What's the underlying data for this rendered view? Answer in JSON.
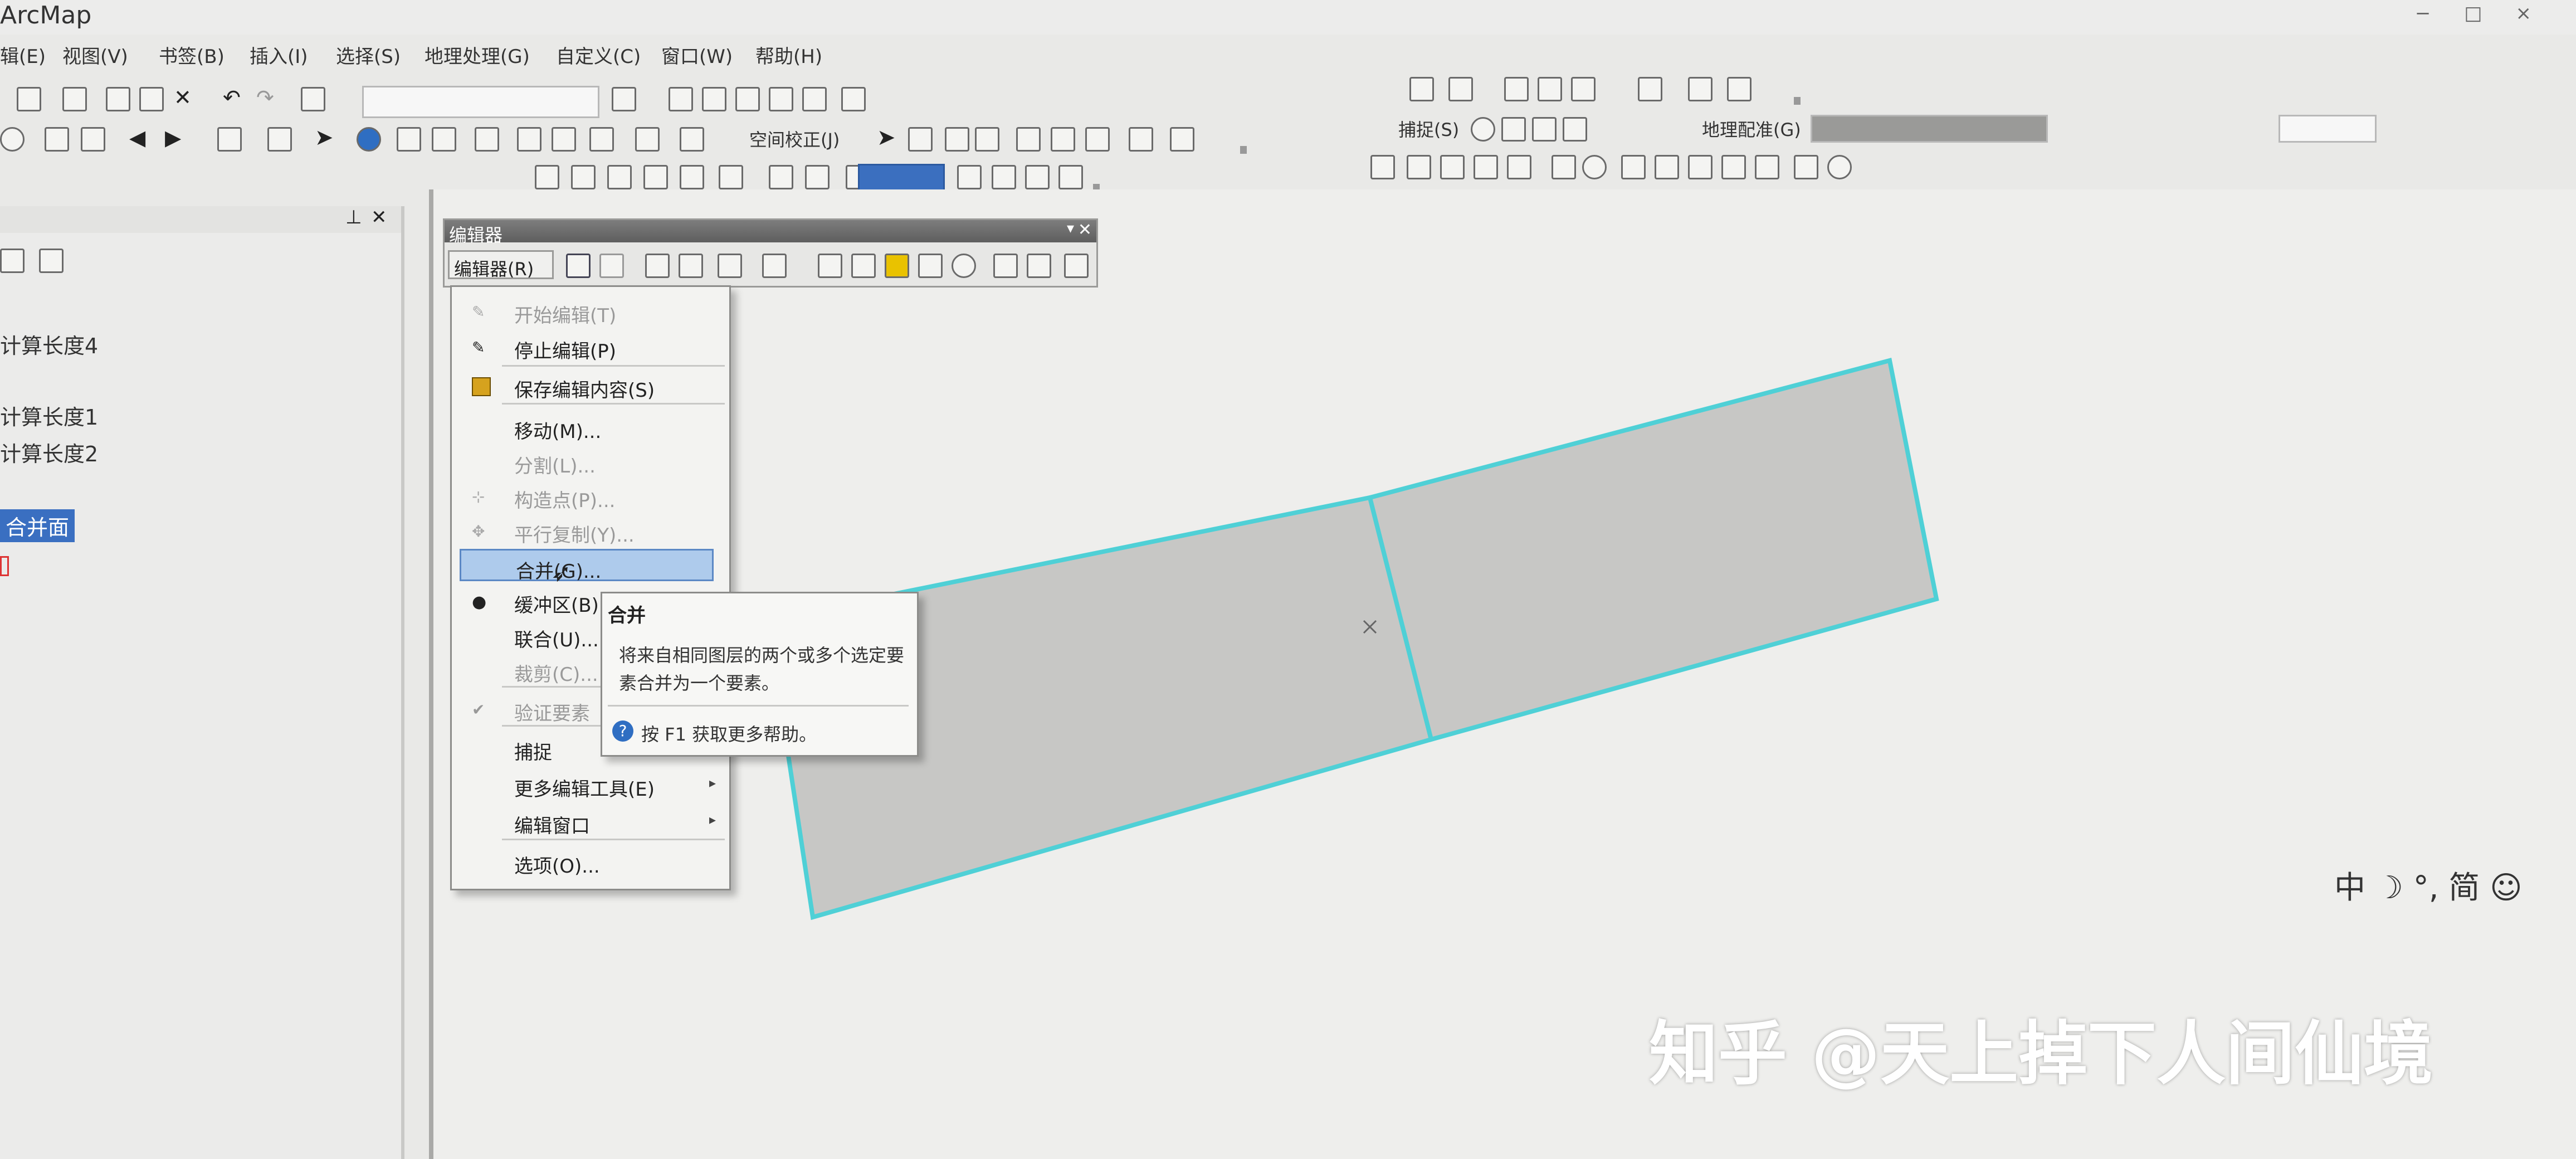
{
  "app": {
    "title": "ArcMap"
  },
  "menubar": [
    {
      "label": "辑(E)"
    },
    {
      "label": "视图(V)"
    },
    {
      "label": "书签(B)"
    },
    {
      "label": "插入(I)"
    },
    {
      "label": "选择(S)"
    },
    {
      "label": "地理处理(G)"
    },
    {
      "label": "自定义(C)"
    },
    {
      "label": "窗口(W)"
    },
    {
      "label": "帮助(H)"
    }
  ],
  "toolbars": {
    "spatial_adjust_label": "空间校正(J)",
    "snapping_label": "捕捉(S)",
    "georef_label": "地理配准(G)"
  },
  "toc": {
    "items": [
      {
        "label": "计算长度4"
      },
      {
        "label": "计算长度1"
      },
      {
        "label": "计算长度2"
      },
      {
        "label": "合并面"
      }
    ]
  },
  "editor_toolbar": {
    "title": "编辑器",
    "menu_button": "编辑器(R)"
  },
  "editor_menu": {
    "items": [
      {
        "label": "开始编辑(T)",
        "disabled": true,
        "icon": "start-edit-icon"
      },
      {
        "label": "停止编辑(P)",
        "disabled": false,
        "icon": "stop-edit-icon"
      },
      {
        "label": "保存编辑内容(S)",
        "disabled": false,
        "icon": "save-edits-icon"
      },
      {
        "label": "移动(M)...",
        "disabled": false,
        "icon": ""
      },
      {
        "label": "分割(L)...",
        "disabled": true,
        "icon": ""
      },
      {
        "label": "构造点(P)...",
        "disabled": true,
        "icon": "construct-points-icon"
      },
      {
        "label": "平行复制(Y)...",
        "disabled": true,
        "icon": "copy-parallel-icon"
      },
      {
        "label": "合并(G)...",
        "disabled": false,
        "icon": "",
        "highlighted": true
      },
      {
        "label": "缓冲区(B)...",
        "disabled": false,
        "icon": "buffer-icon"
      },
      {
        "label": "联合(U)...",
        "disabled": false,
        "icon": ""
      },
      {
        "label": "裁剪(C)...",
        "disabled": true,
        "icon": ""
      },
      {
        "label": "验证要素",
        "disabled": true,
        "icon": "validate-icon"
      },
      {
        "label": "捕捉",
        "disabled": false,
        "icon": "",
        "submenu": true
      },
      {
        "label": "更多编辑工具(E)",
        "disabled": false,
        "icon": "",
        "submenu": true
      },
      {
        "label": "编辑窗口",
        "disabled": false,
        "icon": "",
        "submenu": true
      },
      {
        "label": "选项(O)...",
        "disabled": false,
        "icon": ""
      }
    ]
  },
  "tooltip": {
    "title": "合并",
    "body": "将来自相同图层的两个或多个选定要素合并为一个要素。",
    "help": "按 F1 获取更多帮助。"
  },
  "ime_bar": {
    "text": "中 ☽ °, 简 ☺"
  },
  "watermark": {
    "text": "知乎 @天上掉下人间仙境"
  },
  "colors": {
    "selection_outline": "#4fd0d6",
    "polygon_fill": "#c7c7c5",
    "highlight": "#aecbec",
    "toc_selection": "#3a6fc1"
  }
}
